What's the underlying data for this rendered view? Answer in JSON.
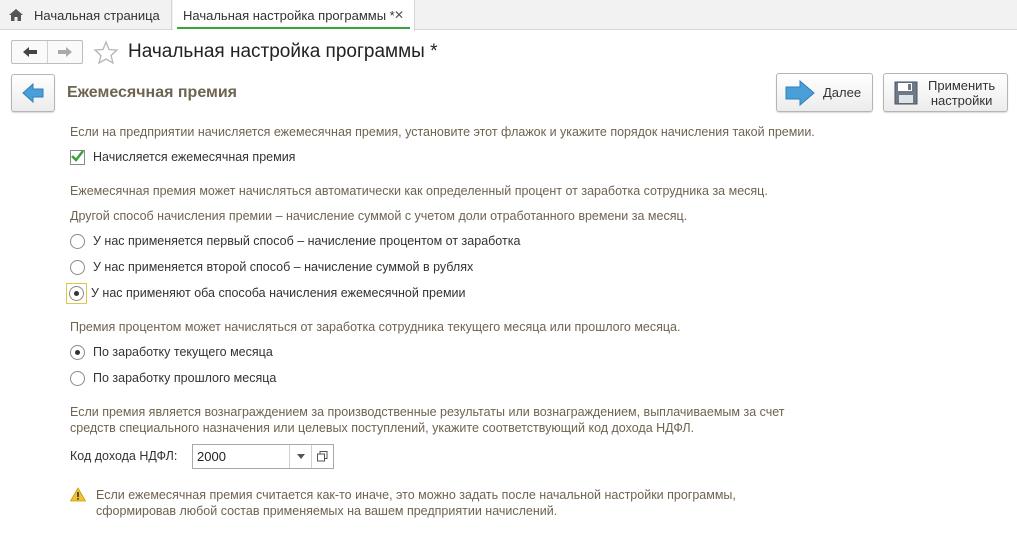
{
  "tabs": {
    "home_label": "Начальная страница",
    "active_label": "Начальная настройка программы *"
  },
  "header": {
    "title": "Начальная настройка программы *"
  },
  "step": {
    "title": "Ежемесячная премия",
    "next_label": "Далее",
    "apply_label_line1": "Применить",
    "apply_label_line2": "настройки"
  },
  "content": {
    "intro": "Если на предприятии начисляется ежемесячная премия, установите этот флажок и укажите порядок начисления такой премии.",
    "checkbox_label": "Начисляется ежемесячная премия",
    "checkbox_checked": true,
    "method_hint_1": "Ежемесячная премия может начисляться автоматически как определенный процент от заработка сотрудника за месяц.",
    "method_hint_2": "Другой способ начисления премии – начисление суммой с учетом доли отработанного времени за месяц.",
    "method_options": [
      {
        "label": "У нас применяется первый способ – начисление процентом от заработка",
        "selected": false
      },
      {
        "label": "У нас применяется второй способ – начисление суммой в рублях",
        "selected": false
      },
      {
        "label": "У нас применяют оба способа начисления ежемесячной премии",
        "selected": true
      }
    ],
    "period_hint": "Премия процентом может начисляться от заработка сотрудника текущего месяца или прошлого месяца.",
    "period_options": [
      {
        "label": "По заработку текущего месяца",
        "selected": true
      },
      {
        "label": "По заработку прошлого месяца",
        "selected": false
      }
    ],
    "ndfl_hint_1": "Если премия является вознаграждением за производственные результаты или вознаграждением, выплачиваемым за счет",
    "ndfl_hint_2": "средств специального назначения или целевых поступлений, укажите соответствующий код дохода НДФЛ.",
    "ndfl_label": "Код дохода НДФЛ:",
    "ndfl_value": "2000",
    "warning_1": "Если ежемесячная премия считается как-то иначе, это можно задать после начальной настройки программы,",
    "warning_2": "сформировав любой состав применяемых на вашем предприятии начислений."
  },
  "colors": {
    "accent_green": "#3aa33a",
    "hint_text": "#6e6450",
    "arrow_blue": "#4a9fd8"
  }
}
